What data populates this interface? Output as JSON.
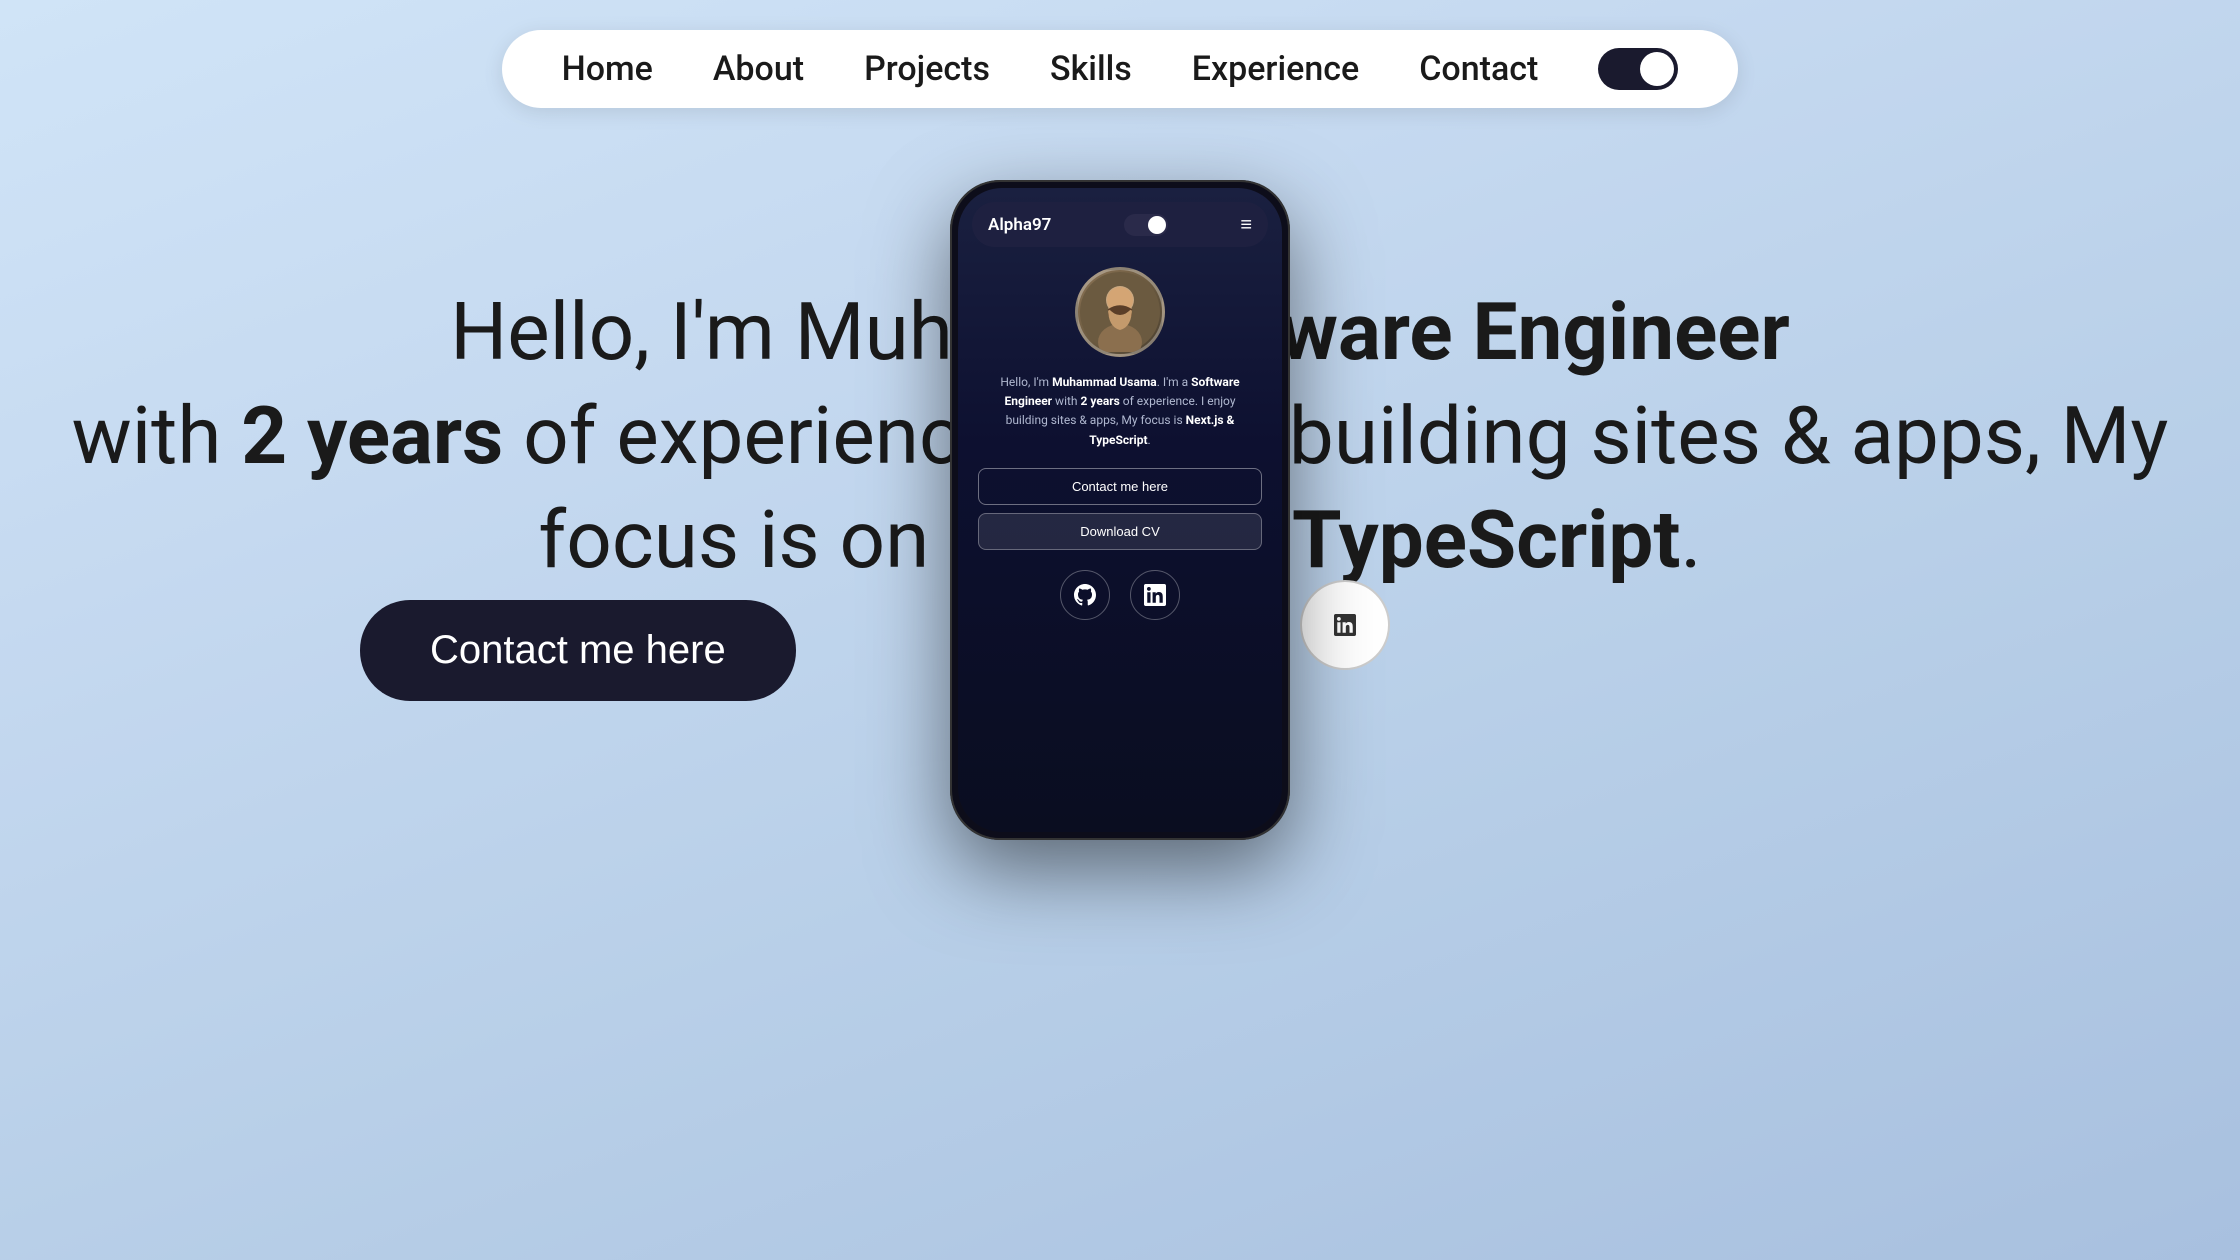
{
  "navbar": {
    "links": [
      {
        "label": "Home",
        "id": "home"
      },
      {
        "label": "About",
        "id": "about"
      },
      {
        "label": "Projects",
        "id": "projects"
      },
      {
        "label": "Skills",
        "id": "skills"
      },
      {
        "label": "Experience",
        "id": "experience"
      },
      {
        "label": "Contact",
        "id": "contact"
      }
    ],
    "toggle_state": "dark"
  },
  "hero": {
    "line1": "Hello, I'm Muhammad Usama, a S",
    "line1_suffix": "oftware Engineer",
    "line2_prefix": "with ",
    "line2_bold": "2 years",
    "line2_middle": " of experience, I enjoy buildi",
    "line2_suffix": "ng sites & apps, My",
    "line3_prefix": "focus is on ",
    "line3_bold": "Next.js & TypeScript",
    "line3_suffix": ".",
    "contact_btn": "Contact me here"
  },
  "phone": {
    "nav": {
      "title": "Alpha97",
      "menu_icon": "≡"
    },
    "bio": {
      "intro": "Hello, I'm ",
      "name": "Muhammad Usama",
      "part2": ". I'm a ",
      "role": "Software Engineer",
      "part3": " with ",
      "years": "2 years",
      "part4": " of experience. I enjoy building sites & apps, My focus is ",
      "tech": "Next.js & TypeScript",
      "period": "."
    },
    "buttons": {
      "contact": "Contact me here",
      "cv": "Download CV"
    },
    "social": {
      "github_title": "GitHub",
      "linkedin_title": "LinkedIn"
    }
  },
  "social_bg": {
    "github_title": "GitHub",
    "linkedin_title": "LinkedIn"
  }
}
